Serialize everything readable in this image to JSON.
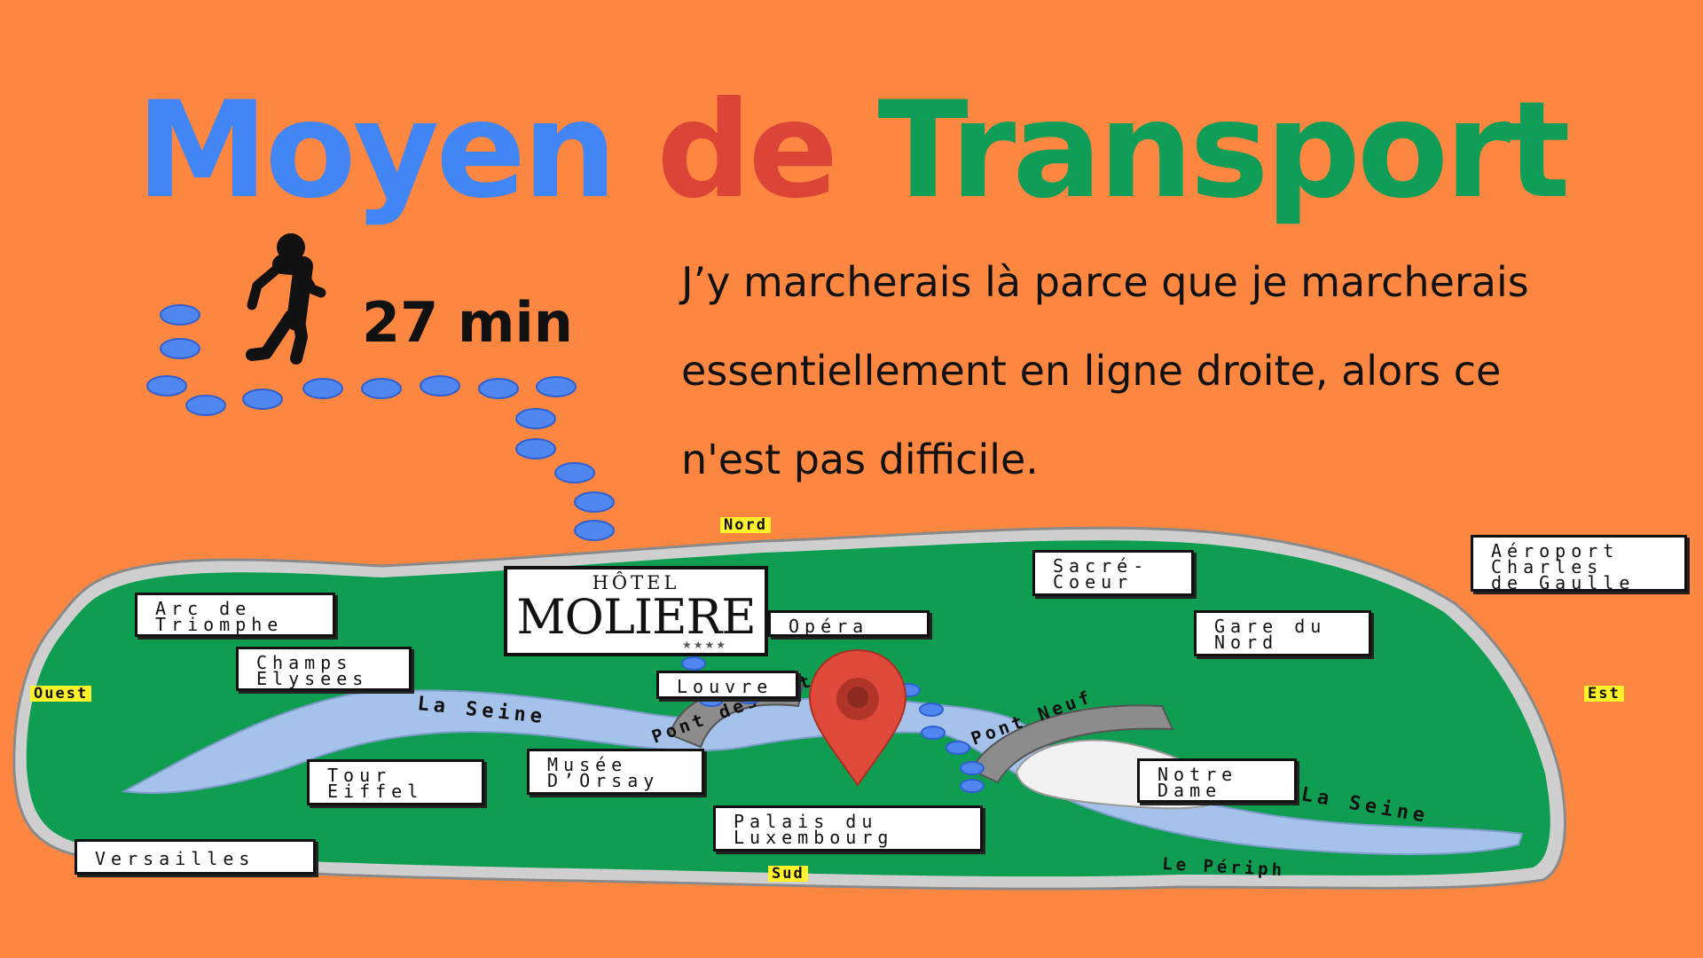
{
  "title": {
    "word1": "Moyen",
    "word2": "de",
    "word3": "Transport"
  },
  "colors": {
    "background": "#fd8740",
    "title_word1": "#4285f4",
    "title_word2": "#db4437",
    "title_word3": "#0f9d58",
    "map_land": "#0f9d52",
    "river": "#a4c2ea",
    "footprints": "#4f86f0",
    "pin": "#e04a3a"
  },
  "walk": {
    "icon": "walking-person-icon",
    "duration": "27 min"
  },
  "description": {
    "line1": "J’y marcherais là parce que je marcherais",
    "line2": "essentiellement en ligne droite, alors ce",
    "line3": "n'est pas difficile."
  },
  "map": {
    "compass": {
      "north": "Nord",
      "south": "Sud",
      "west": "Ouest",
      "east": "Est"
    },
    "hotel": {
      "top": "HÔTEL",
      "name": "MOLIERE",
      "stars": "★★★★"
    },
    "labels": {
      "arc": [
        "Arc de",
        "Triomphe"
      ],
      "champs": [
        "Champs",
        "Elysees"
      ],
      "opera": [
        "Opéra"
      ],
      "louvre": [
        "Louvre"
      ],
      "sacre": [
        "Sacré-",
        "Coeur"
      ],
      "gare": [
        "Gare du",
        "Nord"
      ],
      "aeroport": [
        "Aéroport",
        "Charles",
        "de Gaulle"
      ],
      "tour": [
        "Tour",
        "Eiffel"
      ],
      "orsay": [
        "Musée",
        "D’Orsay"
      ],
      "luxembourg": [
        "Palais du",
        "Luxembourg"
      ],
      "notre_dame": [
        "Notre",
        "Dame"
      ],
      "versailles": [
        "Versailles"
      ]
    },
    "river_name": "La Seine",
    "bridge_1": "Pont des Arts",
    "bridge_2": "Pont Neuf",
    "ring_road": "Le Périph",
    "pin_icon": "location-pin-icon"
  }
}
